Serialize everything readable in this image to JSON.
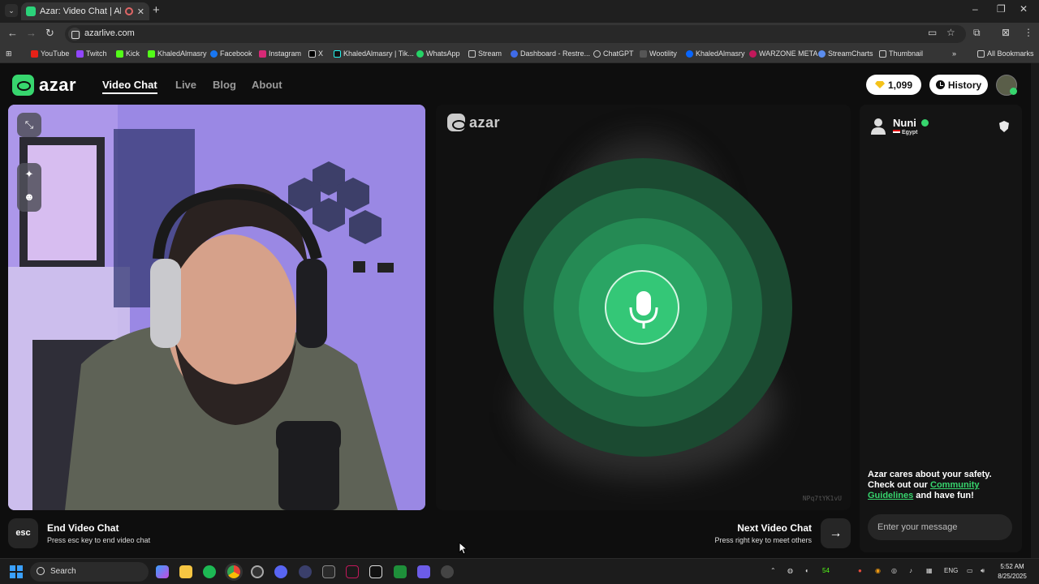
{
  "browser": {
    "tab_title": "Azar: Video Chat | Alternati",
    "url": "azarlive.com",
    "bookmarks": [
      "YouTube",
      "Twitch",
      "Kick",
      "KhaledAlmasry",
      "Facebook",
      "Instagram",
      "X",
      "KhaledAlmasry | Tik...",
      "WhatsApp",
      "Stream",
      "Dashboard - Restre...",
      "ChatGPT",
      "Wootility",
      "KhaledAlmasry",
      "WARZONE META",
      "StreamCharts",
      "Thumbnail"
    ],
    "all_bookmarks": "All Bookmarks"
  },
  "site": {
    "logo": "azar",
    "nav": [
      "Video Chat",
      "Live",
      "Blog",
      "About"
    ],
    "gems": "1,099",
    "history": "History"
  },
  "remote": {
    "logo": "azar",
    "watermark": "NPq7tYK1vU"
  },
  "chat": {
    "peer_name": "Nuni",
    "peer_country": "Egypt",
    "safety_line1": "Azar cares about your safety.",
    "safety_line2": "Check out our ",
    "safety_link": "Community Guidelines",
    "safety_line3": " and have fun!",
    "input_placeholder": "Enter your message"
  },
  "controls": {
    "esc_label": "esc",
    "end_title": "End Video Chat",
    "end_sub": "Press esc key to end video chat",
    "next_title": "Next Video Chat",
    "next_sub": "Press right key to meet others"
  },
  "taskbar": {
    "search": "Search",
    "tray_count": "54",
    "lang": "ENG",
    "time": "5:52 AM",
    "date": "8/25/2025"
  },
  "colors": {
    "accent": "#37d66e",
    "mic_green": "#34c777"
  }
}
